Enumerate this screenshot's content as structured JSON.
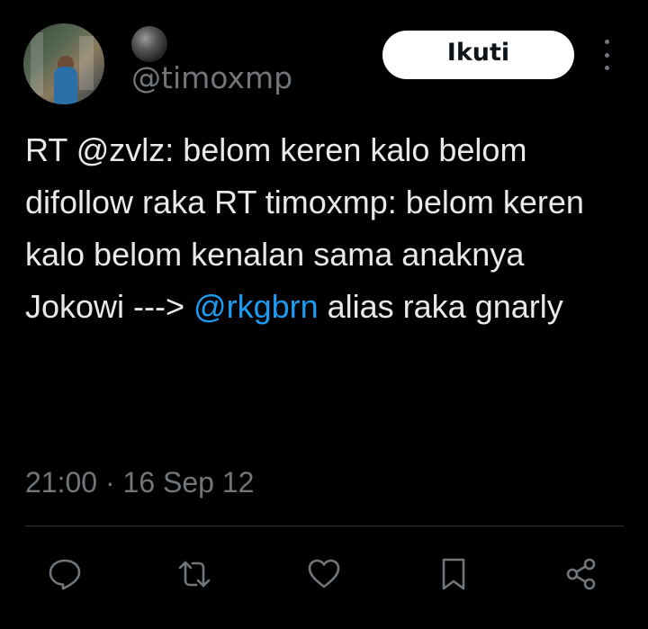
{
  "author": {
    "handle": "@timoxmp",
    "avatar_icon": "profile-photo",
    "badge_icon": "black-sphere"
  },
  "follow_button": {
    "label": "Ikuti"
  },
  "tweet": {
    "text_before": "RT @zvlz: belom keren kalo belom difollow raka RT timoxmp: belom keren kalo belom kenalan sama anaknya Jokowi ---> ",
    "mention": "@rkgbrn",
    "text_after": " alias raka gnarly"
  },
  "meta": {
    "timestamp": "21:00 · 16 Sep 12"
  },
  "actions": [
    {
      "icon": "reply-icon"
    },
    {
      "icon": "retweet-icon"
    },
    {
      "icon": "like-icon"
    },
    {
      "icon": "bookmark-icon"
    },
    {
      "icon": "share-icon"
    }
  ],
  "colors": {
    "background": "#000000",
    "text": "#e7e9ea",
    "secondary": "#71767b",
    "link": "#1d9bf0",
    "button_bg": "#ffffff"
  }
}
